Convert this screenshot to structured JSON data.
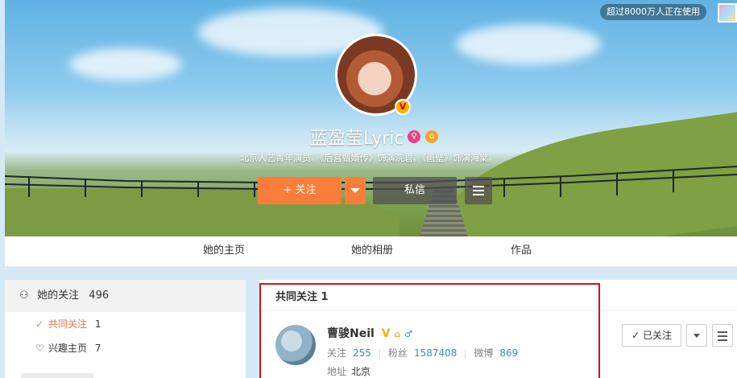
{
  "header": {
    "badge": "超过8000万人正在使用",
    "profile_name": "蓝盈莹Lyric",
    "verified_mark": "V",
    "bio": "北京人艺青年演员。《后宫甄嬛传》饰演浣碧。《画壁》饰演海棠。",
    "follow_label": "+ 关注",
    "message_label": "私信"
  },
  "tabs": [
    "她的主页",
    "她的相册",
    "作品"
  ],
  "sidebar": {
    "head_label": "她的关注",
    "head_count": "496",
    "items": [
      {
        "label": "共同关注",
        "count": "1"
      },
      {
        "label": "兴趣主页",
        "count": "7"
      }
    ]
  },
  "common": {
    "title": "共同关注 1",
    "user": {
      "name": "曹骏Neil",
      "verified_mark": "V",
      "gender": "♂",
      "follow_label": "关注",
      "follow_count": "255",
      "fans_label": "粉丝",
      "fans_count": "1587408",
      "weibo_label": "微博",
      "weibo_count": "869",
      "addr_label": "地址",
      "addr_value": "北京",
      "followed_label": "已关注"
    }
  },
  "colors": {
    "accent": "#fa7d3c",
    "link": "#3c8dc6",
    "highlight_border": "#d0141b"
  }
}
